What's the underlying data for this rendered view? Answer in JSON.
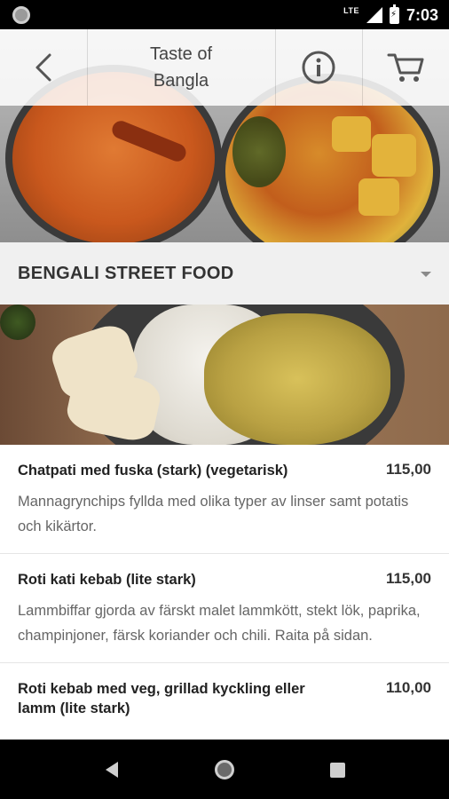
{
  "status_bar": {
    "network": "LTE",
    "time": "7:03"
  },
  "app_bar": {
    "title_line1": "Taste of",
    "title_line2": "Bangla"
  },
  "category": {
    "title": "BENGALI STREET FOOD"
  },
  "menu": {
    "items": [
      {
        "name": "Chatpati med fuska (stark) (vegetarisk)",
        "price": "115,00",
        "description": "Mannagrynchips fyllda med olika typer av linser samt potatis och kikärtor."
      },
      {
        "name": "Roti kati kebab (lite stark)",
        "price": "115,00",
        "description": "Lammbiffar gjorda av färskt malet lammkött, stekt lök, paprika, champinjoner, färsk koriander och chili. Raita på sidan."
      },
      {
        "name": "Roti kebab med veg, grillad kyckling eller lamm (lite stark)",
        "price": "110,00",
        "description": ""
      }
    ]
  },
  "icons": {
    "back": "arrow-left",
    "info": "info-circle",
    "cart": "shopping-cart",
    "dropdown": "caret-down"
  }
}
